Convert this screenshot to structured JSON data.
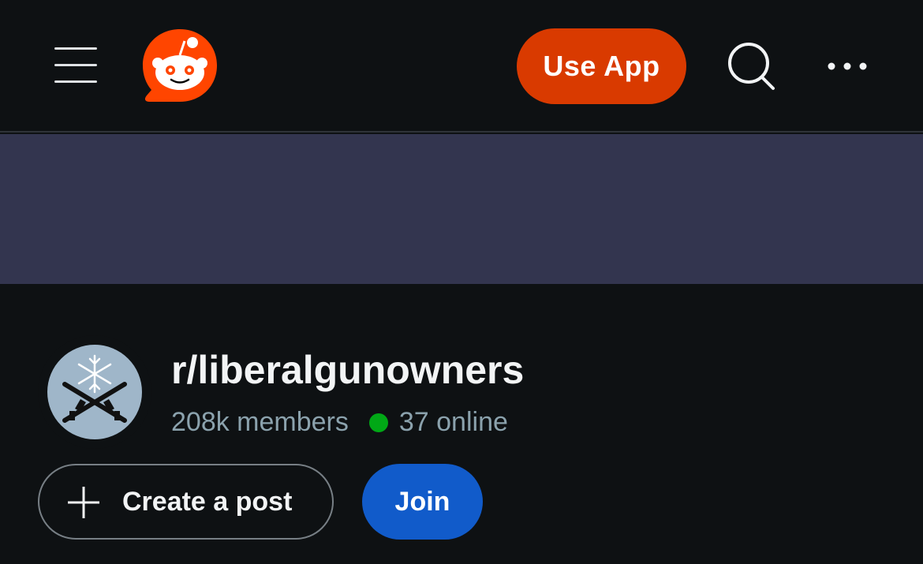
{
  "header": {
    "menu_icon": "hamburger-menu-icon",
    "logo_icon": "reddit-logo-icon",
    "use_app_label": "Use App",
    "search_icon": "search-icon",
    "more_icon": "more-options-icon"
  },
  "colors": {
    "background": "#0e1113",
    "banner": "#33354f",
    "brand_orange": "#d93a00",
    "join_blue": "#115bca",
    "online_green": "#01a816",
    "muted_text": "#8ba2ad"
  },
  "community": {
    "name": "r/liberalgunowners",
    "members": "208k members",
    "online": "37 online",
    "avatar_icon": "snowflake-crossed-rifles-icon"
  },
  "actions": {
    "create_post_label": "Create a post",
    "create_post_icon": "plus-icon",
    "join_label": "Join"
  }
}
